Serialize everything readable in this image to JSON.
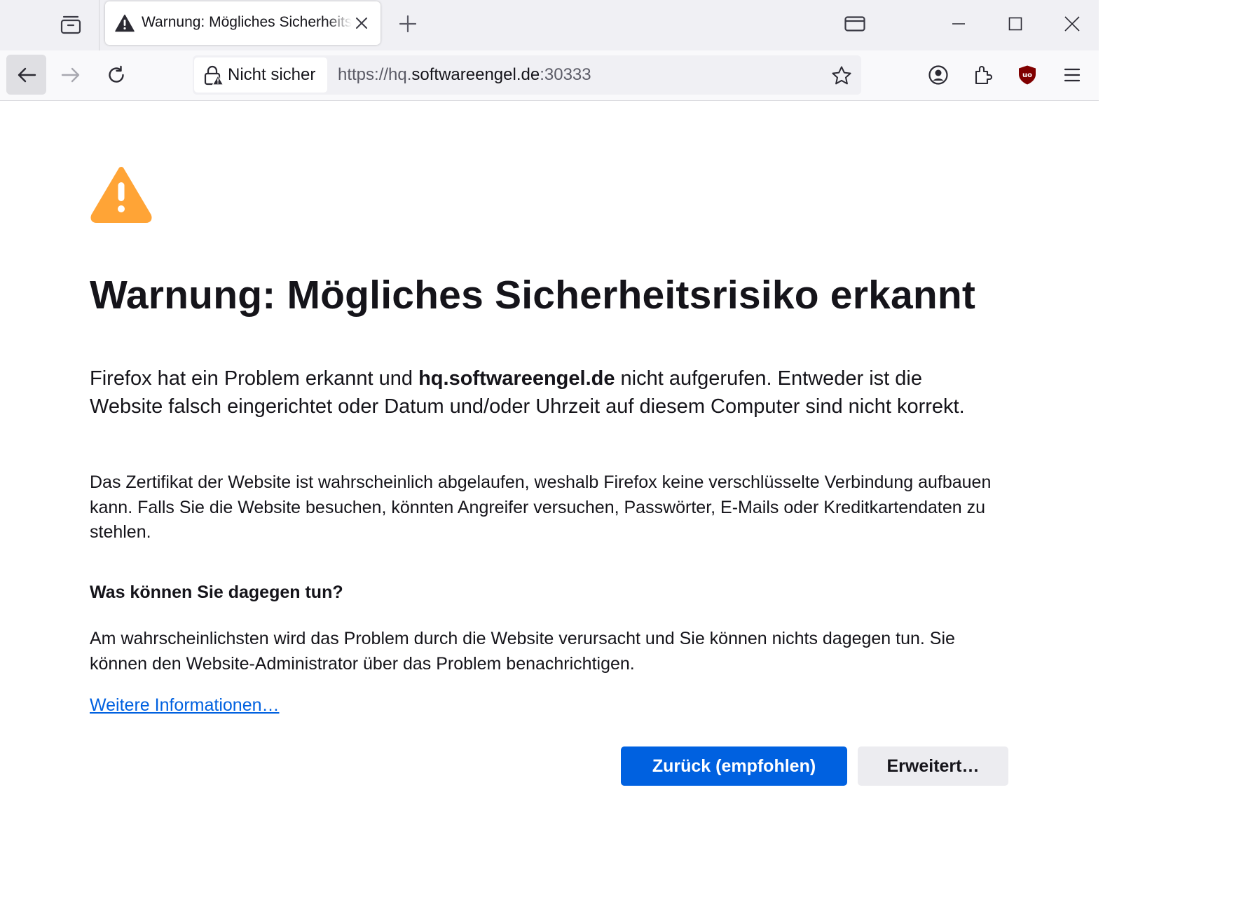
{
  "tab": {
    "title": "Warnung: Mögliches Sicherheitsrisiko erkannt"
  },
  "urlbar": {
    "identity_label": "Nicht sicher",
    "url_prefix": "https://hq.",
    "url_host": "softwareengel.de",
    "url_suffix": ":30333"
  },
  "page": {
    "title": "Warnung: Mögliches Sicherheitsrisiko erkannt",
    "lead_before": "Firefox hat ein Problem erkannt und ",
    "lead_host": "hq.softwareengel.de",
    "lead_after": " nicht aufgerufen. Entweder ist die Website falsch eingerichtet oder Datum und/oder Uhrzeit auf diesem Computer sind nicht korrekt.",
    "cert_text": "Das Zertifikat der Website ist wahrscheinlich abgelaufen, weshalb Firefox keine verschlüsselte Verbindung aufbauen kann. Falls Sie die Website besuchen, könnten Angreifer versuchen, Passwörter, E-Mails oder Kreditkartendaten zu stehlen.",
    "what_heading": "Was können Sie dagegen tun?",
    "what_text": "Am wahrscheinlichsten wird das Problem durch die Website verursacht und Sie können nichts dagegen tun. Sie können den Website-Administrator über das Problem benachrichtigen.",
    "more_link": "Weitere Informationen…",
    "back_button": "Zurück (empfohlen)",
    "advanced_button": "Erweitert…"
  },
  "colors": {
    "primary": "#0061e0",
    "warning": "#ffa436",
    "addon_red": "#800000"
  },
  "icons": [
    "tab-overview-icon",
    "warning-icon",
    "close-icon",
    "plus-icon",
    "sidebar-icon",
    "minimize-icon",
    "maximize-icon",
    "window-close-icon",
    "back-arrow-icon",
    "forward-arrow-icon",
    "reload-icon",
    "insecure-lock-icon",
    "star-icon",
    "account-icon",
    "extensions-icon",
    "ublock-icon",
    "menu-icon"
  ]
}
